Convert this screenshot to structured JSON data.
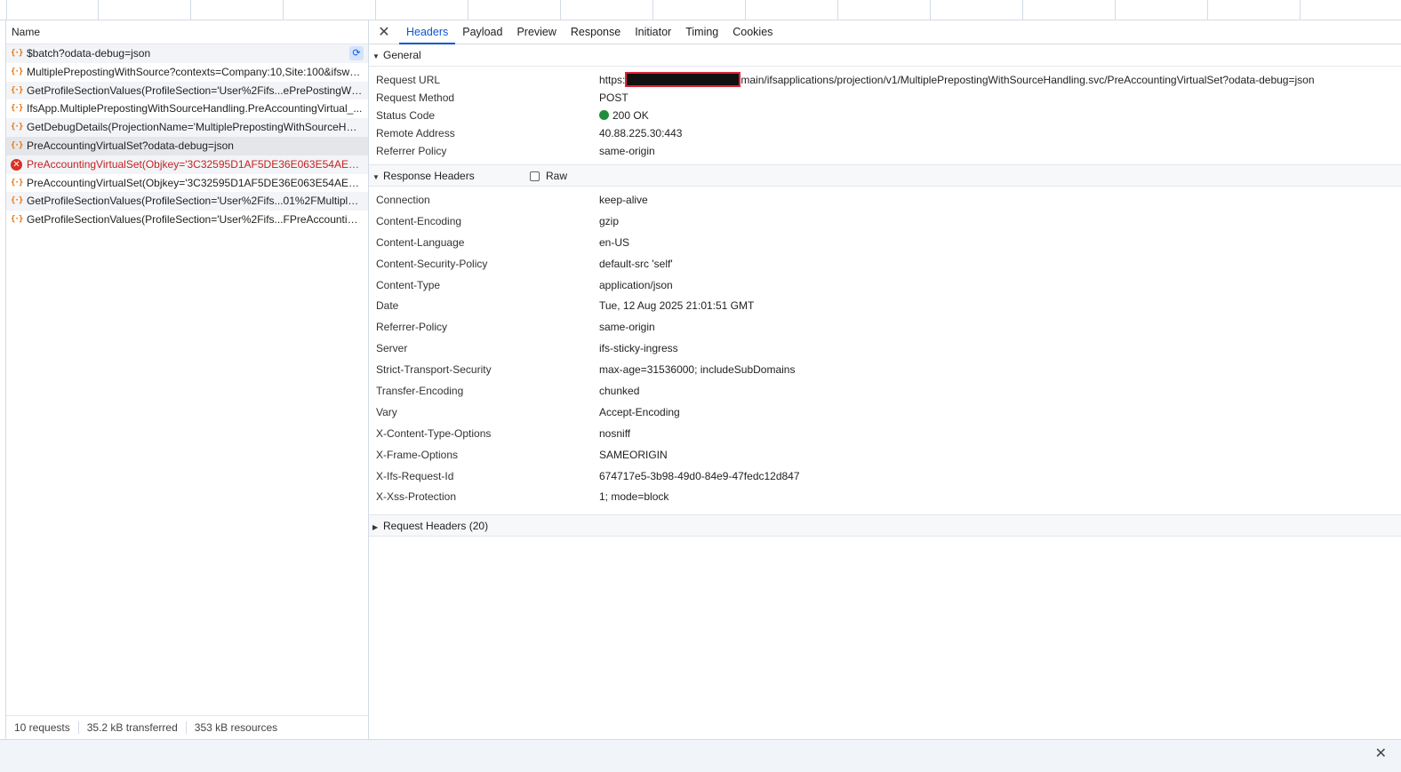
{
  "request_list": {
    "header": "Name",
    "rows": [
      {
        "name": "$batch?odata-debug=json",
        "status": "ok"
      },
      {
        "name": "MultiplePrepostingWithSource?contexts=Company:10,Site:100&ifswe...",
        "status": "ok"
      },
      {
        "name": "GetProfileSectionValues(ProfileSection='User%2Fifs...ePrePostingWithS...",
        "status": "ok"
      },
      {
        "name": "IfsApp.MultiplePrepostingWithSourceHandling.PreAccountingVirtual_...",
        "status": "ok"
      },
      {
        "name": "GetDebugDetails(ProjectionName='MultiplePrepostingWithSourceHan...",
        "status": "ok"
      },
      {
        "name": "PreAccountingVirtualSet?odata-debug=json",
        "status": "selected"
      },
      {
        "name": "PreAccountingVirtualSet(Objkey='3C32595D1AF5DE36E063E54AEF0A...",
        "status": "error"
      },
      {
        "name": "PreAccountingVirtualSet(Objkey='3C32595D1AF5DE36E063E54AEF0A...",
        "status": "ok"
      },
      {
        "name": "GetProfileSectionValues(ProfileSection='User%2Fifs...01%2FMultiplePr...",
        "status": "ok"
      },
      {
        "name": "GetProfileSectionValues(ProfileSection='User%2Fifs...FPreAccountingD...",
        "status": "ok"
      }
    ],
    "status_bar": {
      "requests": "10 requests",
      "transferred": "35.2 kB transferred",
      "resources": "353 kB resources"
    }
  },
  "detail": {
    "tabs": [
      "Headers",
      "Payload",
      "Preview",
      "Response",
      "Initiator",
      "Timing",
      "Cookies"
    ],
    "active_tab": "Headers",
    "general": {
      "title": "General",
      "rows": [
        {
          "key": "Request URL",
          "prefix": "https:",
          "suffix": "main/ifsapplications/projection/v1/MultiplePrepostingWithSourceHandling.svc/PreAccountingVirtualSet?odata-debug=json"
        },
        {
          "key": "Request Method",
          "value": "POST"
        },
        {
          "key": "Status Code",
          "value": "200 OK"
        },
        {
          "key": "Remote Address",
          "value": "40.88.225.30:443"
        },
        {
          "key": "Referrer Policy",
          "value": "same-origin"
        }
      ]
    },
    "response_headers": {
      "title": "Response Headers",
      "raw_label": "Raw",
      "rows": [
        {
          "key": "Connection",
          "value": "keep-alive"
        },
        {
          "key": "Content-Encoding",
          "value": "gzip"
        },
        {
          "key": "Content-Language",
          "value": "en-US"
        },
        {
          "key": "Content-Security-Policy",
          "value": "default-src 'self'"
        },
        {
          "key": "Content-Type",
          "value": "application/json"
        },
        {
          "key": "Date",
          "value": "Tue, 12 Aug 2025 21:01:51 GMT"
        },
        {
          "key": "Referrer-Policy",
          "value": "same-origin"
        },
        {
          "key": "Server",
          "value": "ifs-sticky-ingress"
        },
        {
          "key": "Strict-Transport-Security",
          "value": "max-age=31536000; includeSubDomains"
        },
        {
          "key": "Transfer-Encoding",
          "value": "chunked"
        },
        {
          "key": "Vary",
          "value": "Accept-Encoding"
        },
        {
          "key": "X-Content-Type-Options",
          "value": "nosniff"
        },
        {
          "key": "X-Frame-Options",
          "value": "SAMEORIGIN"
        },
        {
          "key": "X-Ifs-Request-Id",
          "value": "674717e5-3b98-49d0-84e9-47fedc12d847"
        },
        {
          "key": "X-Xss-Protection",
          "value": "1; mode=block"
        }
      ]
    },
    "request_headers": {
      "title": "Request Headers (20)"
    }
  },
  "colors": {
    "accent": "#0b57d0",
    "error": "#c5221f",
    "status_ok": "#1e8e3e",
    "redaction_border": "#e0233b"
  }
}
